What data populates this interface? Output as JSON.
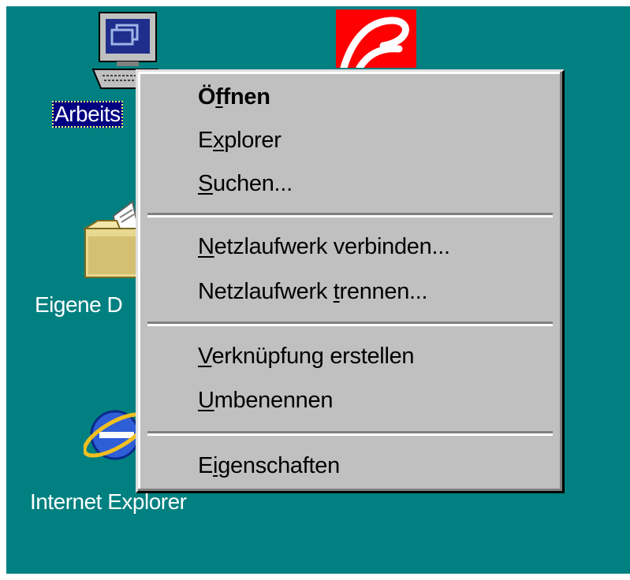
{
  "desktop": {
    "background_color": "#008080",
    "icons": [
      {
        "name": "my-computer-icon",
        "label": "Arbeits",
        "selected": true
      },
      {
        "name": "my-documents-icon",
        "label": "Eigene D"
      },
      {
        "name": "internet-explorer-icon",
        "label": "Internet Explorer"
      },
      {
        "name": "red-app-icon",
        "label": ""
      }
    ]
  },
  "context_menu": {
    "items": [
      {
        "before": "Ö",
        "mnemonic": "f",
        "after": "fnen",
        "default": true
      },
      {
        "before": "E",
        "mnemonic": "x",
        "after": "plorer"
      },
      {
        "before": "",
        "mnemonic": "S",
        "after": "uchen..."
      },
      {
        "before": "",
        "mnemonic": "N",
        "after": "etzlaufwerk verbinden..."
      },
      {
        "before": "Netzlaufwerk ",
        "mnemonic": "t",
        "after": "rennen..."
      },
      {
        "before": "",
        "mnemonic": "V",
        "after": "erknüpfung erstellen"
      },
      {
        "before": "",
        "mnemonic": "U",
        "after": "mbenennen"
      },
      {
        "before": "E",
        "mnemonic": "i",
        "after": "genschaften"
      }
    ]
  }
}
